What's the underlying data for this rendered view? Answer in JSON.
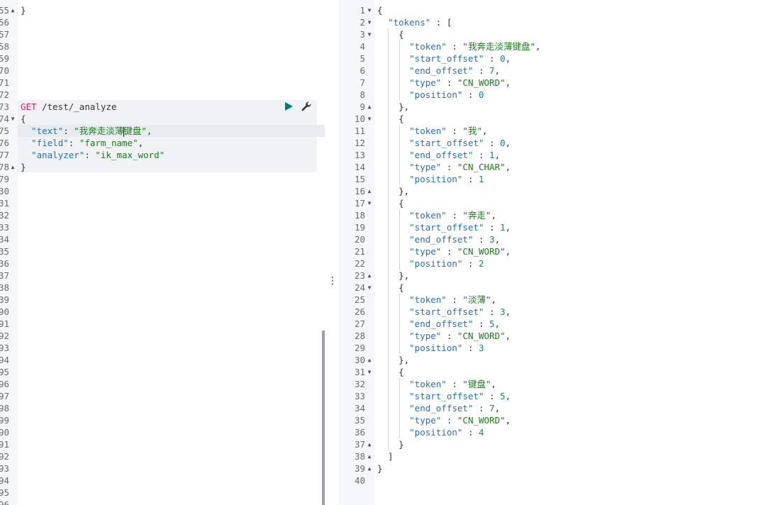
{
  "console": {
    "request": {
      "method": "GET",
      "path": "/test/_analyze",
      "text_key": "\"text\"",
      "text_value_before_cursor": "\"我奔走淡薄",
      "text_value_after_cursor": "键盘\"",
      "field_key": "\"field\"",
      "field_value": "\"farm_name\"",
      "analyzer_key": "\"analyzer\"",
      "analyzer_value": "\"ik_max_word\""
    },
    "left_line_numbers": [
      "55",
      "56",
      "57",
      "58",
      "59",
      "70",
      "71",
      "72",
      "73",
      "74",
      "75",
      "76",
      "77",
      "78",
      "79",
      "30",
      "31",
      "32",
      "33",
      "34",
      "35",
      "36",
      "37",
      "38",
      "39",
      "90",
      "91",
      "92",
      "93",
      "94",
      "95",
      "96",
      "97",
      "98",
      "99",
      "90",
      "91",
      "92",
      "93",
      "94",
      "95",
      "96"
    ],
    "response": {
      "tokens_key": "\"tokens\"",
      "tokens": [
        {
          "token": "\"我奔走淡薄键盘\"",
          "start_offset": "0",
          "end_offset": "7",
          "type": "\"CN_WORD\"",
          "position": "0"
        },
        {
          "token": "\"我\"",
          "start_offset": "0",
          "end_offset": "1",
          "type": "\"CN_CHAR\"",
          "position": "1"
        },
        {
          "token": "\"奔走\"",
          "start_offset": "1",
          "end_offset": "3",
          "type": "\"CN_WORD\"",
          "position": "2"
        },
        {
          "token": "\"淡薄\"",
          "start_offset": "3",
          "end_offset": "5",
          "type": "\"CN_WORD\"",
          "position": "3"
        },
        {
          "token": "\"键盘\"",
          "start_offset": "5",
          "end_offset": "7",
          "type": "\"CN_WORD\"",
          "position": "4"
        }
      ],
      "labels": {
        "token": "\"token\"",
        "start_offset": "\"start_offset\"",
        "end_offset": "\"end_offset\"",
        "type": "\"type\"",
        "position": "\"position\""
      },
      "total_lines": 40
    }
  },
  "icons": {
    "run": "play-icon",
    "wrench": "wrench-icon",
    "fold_open": "caret-down-icon",
    "fold_close": "caret-up-icon",
    "resize": "vertical-dots-icon"
  },
  "colors": {
    "method": "#c12b5e",
    "key": "#2a6fb5",
    "string": "#1a7d1a",
    "number": "#168479",
    "run_button": "#017d73",
    "gutter": "#f5f7fa"
  }
}
